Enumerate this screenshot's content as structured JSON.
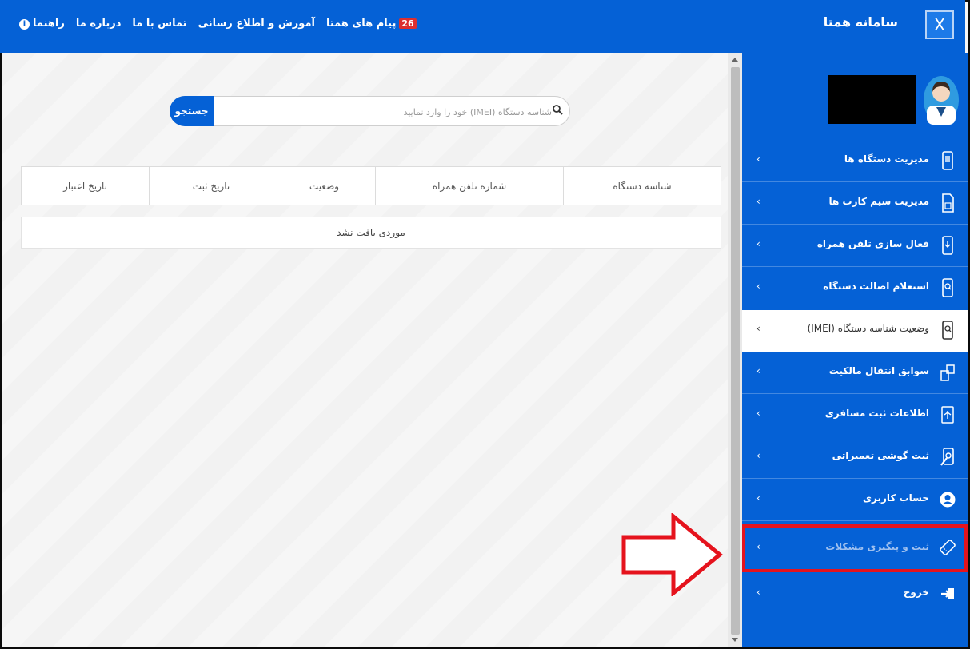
{
  "topbar": {
    "title": "سامانه همتا",
    "close_label": "X",
    "nav": {
      "guide": "راهنما",
      "about": "درباره ما",
      "contact": "تماس با ما",
      "training": "آموزش و اطلاع رسانی",
      "messages": "پیام های همتا",
      "messages_count": "26"
    }
  },
  "search": {
    "placeholder": "شناسه دستگاه (IMEI) خود را وارد نمایید",
    "button_label": "جستجو"
  },
  "table": {
    "columns": [
      "شناسه دستگاه",
      "شماره تلفن همراه",
      "وضعیت",
      "تاریخ ثبت",
      "تاریخ اعتبار"
    ],
    "empty_message": "موردی یافت نشد"
  },
  "sidebar": {
    "items": [
      {
        "label": "مدیریت دستگاه ها",
        "icon": "phone-icon"
      },
      {
        "label": "مدیریت سیم کارت ها",
        "icon": "sim-card-icon"
      },
      {
        "label": "فعال سازی تلفن همراه",
        "icon": "phone-activate-icon"
      },
      {
        "label": "استعلام اصالت دستگاه",
        "icon": "phone-search-icon"
      },
      {
        "label": "وضعیت شناسه دستگاه (IMEI)",
        "icon": "phone-search-icon"
      },
      {
        "label": "سوابق انتقال مالکیت",
        "icon": "transfer-icon"
      },
      {
        "label": "اطلاعات ثبت مسافری",
        "icon": "passenger-icon"
      },
      {
        "label": "ثبت گوشی تعمیراتی",
        "icon": "repair-icon"
      },
      {
        "label": "حساب کاربری",
        "icon": "user-account-icon"
      },
      {
        "label": "ثبت و پیگیری مشکلات",
        "icon": "ticket-icon"
      },
      {
        "label": "خروج",
        "icon": "logout-icon"
      }
    ],
    "chevron": "‹"
  },
  "colors": {
    "primary": "#0561d6",
    "highlight": "#e5131d",
    "badge": "#dc2f2f"
  }
}
